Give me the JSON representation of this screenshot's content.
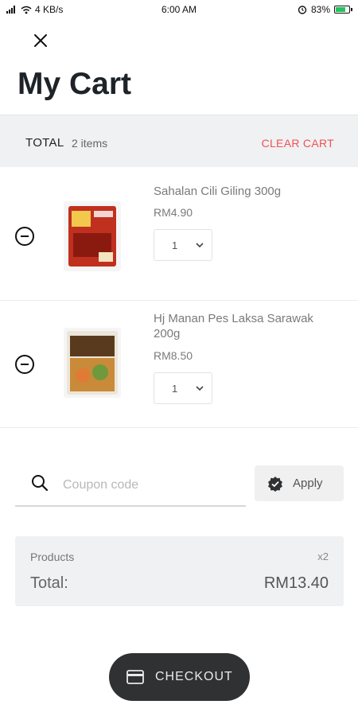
{
  "status_bar": {
    "signal": "4 KB/s",
    "time": "6:00 AM",
    "battery_percent": "83%",
    "battery_level": 0.83,
    "battery_color": "#22c55e"
  },
  "header": {
    "title": "My Cart"
  },
  "total_bar": {
    "label": "TOTAL",
    "count": "2 items",
    "clear_label": "CLEAR CART",
    "clear_color": "#ef5350"
  },
  "items": [
    {
      "name": "Sahalan Cili Giling 300g",
      "price": "RM4.90",
      "quantity": "1"
    },
    {
      "name": "Hj Manan Pes Laksa Sarawak 200g",
      "price": "RM8.50",
      "quantity": "1"
    }
  ],
  "coupon": {
    "placeholder": "Coupon code",
    "apply_label": "Apply"
  },
  "summary": {
    "products_label": "Products",
    "products_count": "x2",
    "total_label": "Total:",
    "total_value": "RM13.40"
  },
  "checkout": {
    "label": "CHECKOUT"
  }
}
